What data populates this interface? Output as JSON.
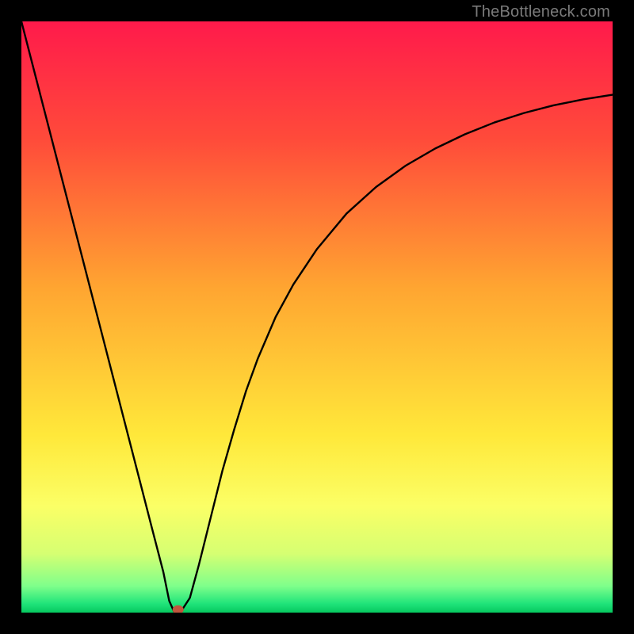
{
  "watermark": {
    "text": "TheBottleneck.com"
  },
  "chart_data": {
    "type": "line",
    "title": "",
    "xlabel": "",
    "ylabel": "",
    "xlim": [
      0,
      100
    ],
    "ylim": [
      0,
      100
    ],
    "grid": false,
    "background_gradient": {
      "stops": [
        {
          "offset": 0.0,
          "color": "#ff1a4b"
        },
        {
          "offset": 0.2,
          "color": "#ff4b3a"
        },
        {
          "offset": 0.45,
          "color": "#ffa531"
        },
        {
          "offset": 0.7,
          "color": "#ffe83a"
        },
        {
          "offset": 0.82,
          "color": "#fbff66"
        },
        {
          "offset": 0.9,
          "color": "#d6ff72"
        },
        {
          "offset": 0.955,
          "color": "#7fff8b"
        },
        {
          "offset": 0.985,
          "color": "#20e47a"
        },
        {
          "offset": 1.0,
          "color": "#06c85f"
        }
      ]
    },
    "series": [
      {
        "name": "bottleneck-curve",
        "x": [
          0.0,
          2.5,
          5.0,
          7.5,
          10.0,
          12.5,
          15.0,
          17.5,
          20.0,
          22.0,
          24.0,
          25.0,
          25.8,
          27.0,
          28.5,
          30.0,
          32.0,
          34.0,
          36.0,
          38.0,
          40.0,
          43.0,
          46.0,
          50.0,
          55.0,
          60.0,
          65.0,
          70.0,
          75.0,
          80.0,
          85.0,
          90.0,
          95.0,
          100.0
        ],
        "y": [
          100.0,
          90.3,
          80.6,
          70.9,
          61.2,
          51.5,
          41.8,
          32.1,
          22.4,
          14.6,
          6.9,
          2.0,
          0.2,
          0.2,
          2.5,
          8.0,
          16.0,
          24.0,
          31.0,
          37.5,
          43.0,
          50.0,
          55.5,
          61.5,
          67.5,
          72.0,
          75.6,
          78.5,
          80.9,
          82.9,
          84.5,
          85.8,
          86.8,
          87.6
        ]
      }
    ],
    "marker": {
      "name": "optimal-point",
      "x": 26.5,
      "y": 0.5,
      "color": "#c0563e"
    }
  }
}
